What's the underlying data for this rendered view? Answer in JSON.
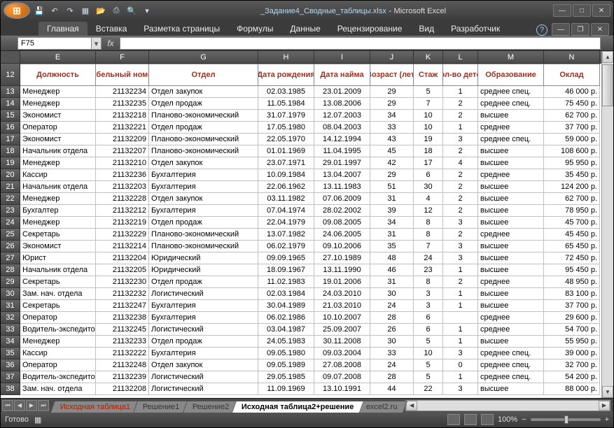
{
  "title": {
    "filename": "_Задание4_Сводные_таблицы.xlsx",
    "app": "Microsoft Excel"
  },
  "qat_icons": [
    "save",
    "undo",
    "redo",
    "sep",
    "new",
    "open",
    "print",
    "preview",
    "quick",
    "sort",
    "filter"
  ],
  "ribbon": [
    "Главная",
    "Вставка",
    "Разметка страницы",
    "Формулы",
    "Данные",
    "Рецензирование",
    "Вид",
    "Разработчик"
  ],
  "active_ribbon": 0,
  "namebox": "F75",
  "fx": "fx",
  "cols": [
    "E",
    "F",
    "G",
    "H",
    "I",
    "J",
    "K",
    "L",
    "M",
    "N"
  ],
  "first_row": 12,
  "headers": [
    "Должность",
    "Табельный номер",
    "Отдел",
    "Дата рождения",
    "Дата найма",
    "Возраст (лет)",
    "Стаж",
    "Кол-во детей",
    "Образование",
    "Оклад"
  ],
  "rows": [
    [
      "Менеджер",
      "21132234",
      "Отдел закупок",
      "02.03.1985",
      "23.01.2009",
      "29",
      "5",
      "1",
      "среднее спец.",
      "46 000 р."
    ],
    [
      "Менеджер",
      "21132235",
      "Отдел продаж",
      "11.05.1984",
      "13.08.2006",
      "29",
      "7",
      "2",
      "среднее спец.",
      "75 450 р."
    ],
    [
      "Экономист",
      "21132218",
      "Планово-экономический",
      "31.07.1979",
      "12.07.2003",
      "34",
      "10",
      "2",
      "высшее",
      "62 700 р."
    ],
    [
      "Оператор",
      "21132221",
      "Отдел продаж",
      "17.05.1980",
      "08.04.2003",
      "33",
      "10",
      "1",
      "среднее",
      "37 700 р."
    ],
    [
      "Экономист",
      "21132209",
      "Планово-экономический",
      "22.05.1970",
      "14.12.1994",
      "43",
      "19",
      "3",
      "среднее спец.",
      "59 000 р."
    ],
    [
      "Начальник отдела",
      "21132207",
      "Планово-экономический",
      "01.01.1969",
      "11.04.1995",
      "45",
      "18",
      "2",
      "высшее",
      "108 600 р."
    ],
    [
      "Менеджер",
      "21132210",
      "Отдел закупок",
      "23.07.1971",
      "29.01.1997",
      "42",
      "17",
      "4",
      "высшее",
      "95 950 р."
    ],
    [
      "Кассир",
      "21132236",
      "Бухгалтерия",
      "10.09.1984",
      "13.04.2007",
      "29",
      "6",
      "2",
      "среднее",
      "35 450 р."
    ],
    [
      "Начальник отдела",
      "21132203",
      "Бухгалтерия",
      "22.06.1962",
      "13.11.1983",
      "51",
      "30",
      "2",
      "высшее",
      "124 200 р."
    ],
    [
      "Менеджер",
      "21132228",
      "Отдел закупок",
      "03.11.1982",
      "07.06.2009",
      "31",
      "4",
      "2",
      "высшее",
      "62 700 р."
    ],
    [
      "Бухгалтер",
      "21132212",
      "Бухгалтерия",
      "07.04.1974",
      "28.02.2002",
      "39",
      "12",
      "2",
      "высшее",
      "78 950 р."
    ],
    [
      "Менеджер",
      "21132219",
      "Отдел продаж",
      "22.04.1979",
      "09.08.2005",
      "34",
      "8",
      "3",
      "высшее",
      "45 700 р."
    ],
    [
      "Секретарь",
      "21132229",
      "Планово-экономический",
      "13.07.1982",
      "24.06.2005",
      "31",
      "8",
      "2",
      "среднее",
      "45 450 р."
    ],
    [
      "Экономист",
      "21132214",
      "Планово-экономический",
      "06.02.1979",
      "09.10.2006",
      "35",
      "7",
      "3",
      "высшее",
      "65 450 р."
    ],
    [
      "Юрист",
      "21132204",
      "Юридический",
      "09.09.1965",
      "27.10.1989",
      "48",
      "24",
      "3",
      "высшее",
      "72 450 р."
    ],
    [
      "Начальник отдела",
      "21132205",
      "Юридический",
      "18.09.1967",
      "13.11.1990",
      "46",
      "23",
      "1",
      "высшее",
      "95 450 р."
    ],
    [
      "Секретарь",
      "21132230",
      "Отдел продаж",
      "11.02.1983",
      "19.01.2006",
      "31",
      "8",
      "2",
      "среднее",
      "48 950 р."
    ],
    [
      "Зам. нач. отдела",
      "21132232",
      "Логистический",
      "02.03.1984",
      "24.03.2010",
      "30",
      "3",
      "1",
      "высшее",
      "83 100 р."
    ],
    [
      "Секретарь",
      "21132247",
      "Бухгалтерия",
      "30.04.1989",
      "21.03.2010",
      "24",
      "3",
      "1",
      "высшее",
      "37 700 р."
    ],
    [
      "Оператор",
      "21132238",
      "Бухгалтерия",
      "06.02.1986",
      "10.10.2007",
      "28",
      "6",
      "",
      "среднее",
      "29 600 р."
    ],
    [
      "Водитель-экспедитор",
      "21132245",
      "Логистический",
      "03.04.1987",
      "25.09.2007",
      "26",
      "6",
      "1",
      "среднее",
      "54 700 р."
    ],
    [
      "Менеджер",
      "21132233",
      "Отдел продаж",
      "24.05.1983",
      "30.11.2008",
      "30",
      "5",
      "1",
      "высшее",
      "55 950 р."
    ],
    [
      "Кассир",
      "21132222",
      "Бухгалтерия",
      "09.05.1980",
      "09.03.2004",
      "33",
      "10",
      "3",
      "среднее спец.",
      "39 000 р."
    ],
    [
      "Оператор",
      "21132248",
      "Отдел закупок",
      "09.05.1989",
      "27.08.2008",
      "24",
      "5",
      "0",
      "среднее спец.",
      "32 700 р."
    ],
    [
      "Водитель-экспедитор",
      "21132239",
      "Логистический",
      "29.05.1985",
      "09.07.2008",
      "28",
      "5",
      "1",
      "среднее спец.",
      "54 200 р."
    ],
    [
      "Зам. нач. отдела",
      "21132208",
      "Логистический",
      "11.09.1969",
      "13.10.1991",
      "44",
      "22",
      "3",
      "высшее",
      "88 000 р."
    ]
  ],
  "sheets": [
    {
      "label": "Исходная таблица1",
      "active": false,
      "red": true
    },
    {
      "label": "Решение1",
      "active": false,
      "red": false
    },
    {
      "label": "Решение2",
      "active": false,
      "red": false
    },
    {
      "label": "Исходная таблица2+решение",
      "active": true,
      "red": false
    },
    {
      "label": "excel2.ru",
      "active": false,
      "red": false
    }
  ],
  "status": "Готово",
  "zoom": "100%"
}
